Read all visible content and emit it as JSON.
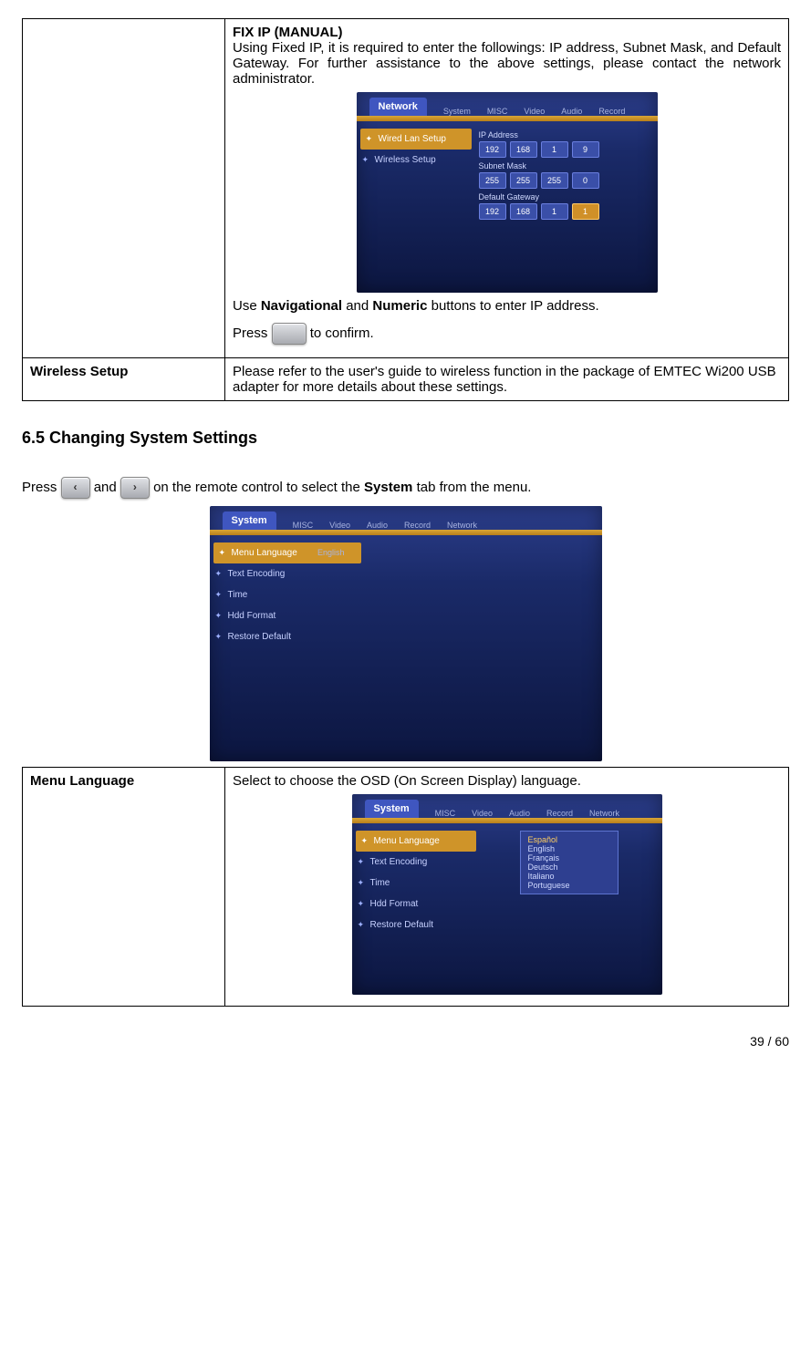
{
  "row_fixip": {
    "title": "FIX IP (MANUAL)",
    "para": "Using Fixed IP, it is required to enter the followings: IP address, Subnet Mask, and Default Gateway. For further assistance to the above settings, please contact the network administrator.",
    "use_line_pre": "Use ",
    "use_b1": "Navigational",
    "use_mid": " and ",
    "use_b2": "Numeric",
    "use_post": " buttons to enter IP address.",
    "press_pre": "Press ",
    "press_post": " to confirm."
  },
  "row_wireless": {
    "label": "Wireless Setup",
    "text": "Please refer to the user's guide to wireless function in the package of EMTEC Wi200 USB adapter for more details about these settings."
  },
  "section_heading": "6.5 Changing System Settings",
  "press_system": {
    "pre": "Press ",
    "mid": " and ",
    "mid2": " on the remote control to select the ",
    "tab": "System",
    "post": " tab from the menu."
  },
  "row_menu": {
    "label": "Menu Language",
    "text": "Select to choose the OSD (On Screen Display) language."
  },
  "shot_net": {
    "tabs": [
      "System",
      "MISC",
      "Video",
      "Audio",
      "Record"
    ],
    "active_tab": "Network",
    "side": [
      "Wired Lan Setup",
      "Wireless Setup"
    ],
    "side_active": 0,
    "ip_label": "IP Address",
    "ip": [
      "192",
      "168",
      "1",
      "9"
    ],
    "mask_label": "Subnet Mask",
    "mask": [
      "255",
      "255",
      "255",
      "0"
    ],
    "gw_label": "Default Gateway",
    "gw": [
      "192",
      "168",
      "1",
      "1"
    ]
  },
  "shot_sys": {
    "active_tab": "System",
    "tabs": [
      "MISC",
      "Video",
      "Audio",
      "Record",
      "Network"
    ],
    "side": [
      "Menu Language",
      "Text Encoding",
      "Time",
      "Hdd Format",
      "Restore Default"
    ],
    "side_active": 0,
    "value": "English"
  },
  "shot_lang": {
    "active_tab": "System",
    "tabs": [
      "MISC",
      "Video",
      "Audio",
      "Record",
      "Network"
    ],
    "side": [
      "Menu Language",
      "Text Encoding",
      "Time",
      "Hdd Format",
      "Restore Default"
    ],
    "side_active": 0,
    "langs": [
      "Español",
      "English",
      "Français",
      "Deutsch",
      "Italiano",
      "Portuguese"
    ],
    "lang_sel": 0
  },
  "footer": "39 / 60"
}
